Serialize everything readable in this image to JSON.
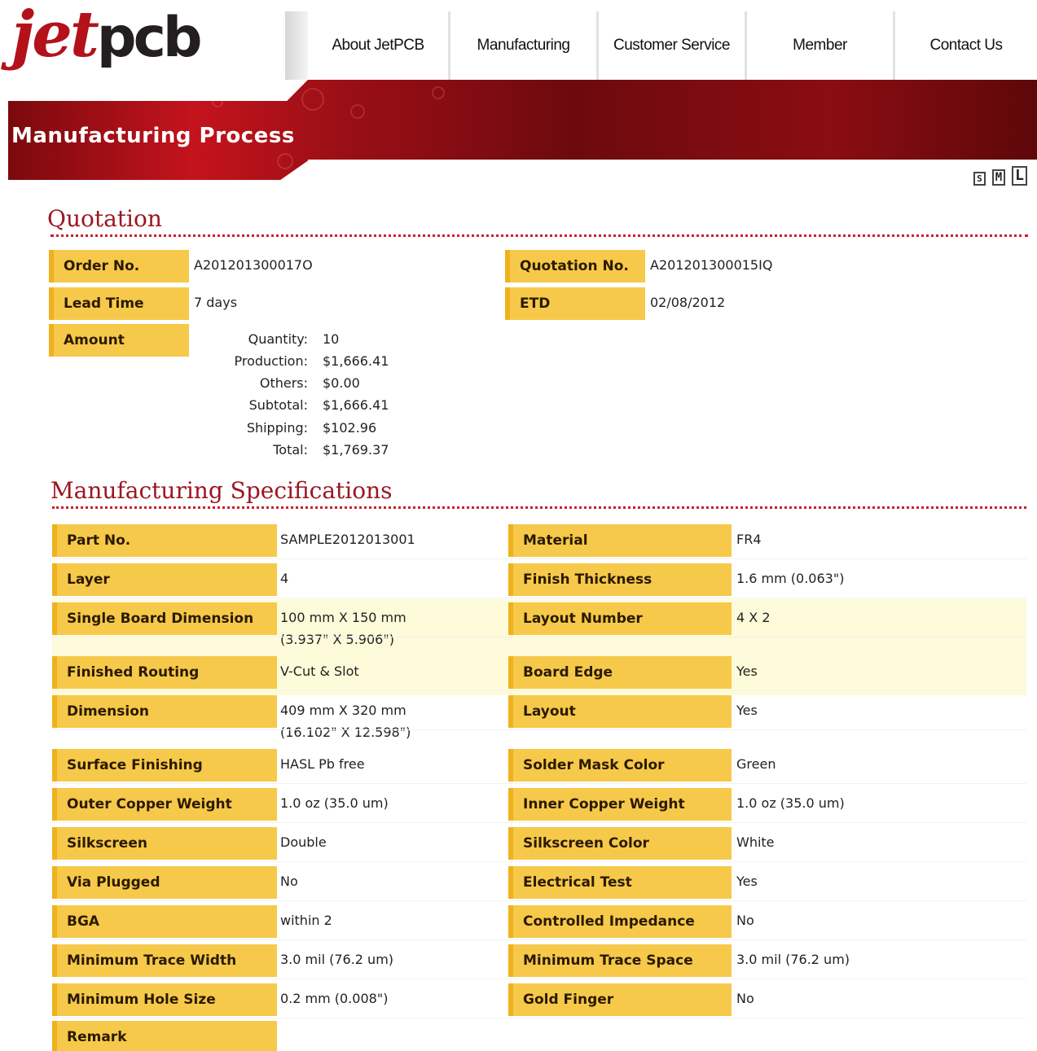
{
  "logo": {
    "part1": "jet",
    "part2": "pcb"
  },
  "nav": [
    "About JetPCB",
    "Manufacturing",
    "Customer Service",
    "Member",
    "Contact Us"
  ],
  "banner": {
    "title": "Manufacturing Process"
  },
  "text_size": {
    "small": "S",
    "medium": "M",
    "large": "L"
  },
  "quotation": {
    "title": "Quotation",
    "order_no_label": "Order No.",
    "order_no": "A201201300017O",
    "quotation_no_label": "Quotation No.",
    "quotation_no": "A201201300015IQ",
    "lead_time_label": "Lead Time",
    "lead_time": "7 days",
    "etd_label": "ETD",
    "etd": "02/08/2012",
    "amount_label": "Amount",
    "amount": [
      {
        "key": "Quantity:",
        "value": "10"
      },
      {
        "key": "Production:",
        "value": "$1,666.41"
      },
      {
        "key": "Others:",
        "value": "$0.00"
      },
      {
        "key": "Subtotal:",
        "value": "$1,666.41"
      },
      {
        "key": "Shipping:",
        "value": "$102.96"
      },
      {
        "key": "Total:",
        "value": "$1,769.37"
      }
    ]
  },
  "specs": {
    "title": "Manufacturing Specifications",
    "rows": [
      {
        "l_label": "Part No.",
        "l_value": "SAMPLE2012013001",
        "r_label": "Material",
        "r_value": "FR4"
      },
      {
        "l_label": "Layer",
        "l_value": "4",
        "r_label": "Finish Thickness",
        "r_value": "1.6 mm (0.063\")"
      },
      {
        "l_label": "Single Board Dimension",
        "l_value": "100 mm X 150 mm",
        "l_value2": "(3.937\" X 5.906\")",
        "r_label": "Layout Number",
        "r_value": "4 X 2"
      },
      {
        "l_label": "Finished Routing",
        "l_value": "V-Cut & Slot",
        "r_label": "Board Edge",
        "r_value": "Yes"
      },
      {
        "l_label": "Dimension",
        "l_value": "409 mm X 320 mm",
        "l_value2": "(16.102\" X 12.598\")",
        "r_label": "Layout",
        "r_value": "Yes"
      },
      {
        "l_label": "Surface Finishing",
        "l_value": "HASL Pb free",
        "r_label": "Solder Mask Color",
        "r_value": "Green"
      },
      {
        "l_label": "Outer Copper Weight",
        "l_value": "1.0 oz (35.0 um)",
        "r_label": "Inner Copper Weight",
        "r_value": "1.0 oz (35.0 um)"
      },
      {
        "l_label": "Silkscreen",
        "l_value": "Double",
        "r_label": "Silkscreen Color",
        "r_value": "White"
      },
      {
        "l_label": "Via Plugged",
        "l_value": "No",
        "r_label": "Electrical Test",
        "r_value": "Yes"
      },
      {
        "l_label": "BGA",
        "l_value": "within 2",
        "r_label": "Controlled Impedance",
        "r_value": "No"
      },
      {
        "l_label": "Minimum Trace Width",
        "l_value": "3.0 mil (76.2 um)",
        "r_label": "Minimum Trace Space",
        "r_value": "3.0 mil (76.2 um)"
      },
      {
        "l_label": "Minimum Hole Size",
        "l_value": "0.2 mm (0.008\")",
        "r_label": "Gold Finger",
        "r_value": "No"
      }
    ],
    "remark_label": "Remark"
  },
  "colors": {
    "brand_red": "#b3121b",
    "label_yellow": "#f6c94a",
    "section_title": "#9b1622"
  }
}
